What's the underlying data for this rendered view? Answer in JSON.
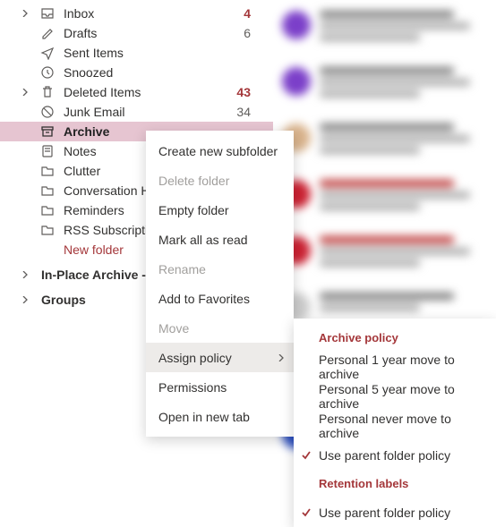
{
  "folders": {
    "inbox": {
      "label": "Inbox",
      "count": "4",
      "bold": true
    },
    "drafts": {
      "label": "Drafts",
      "count": "6"
    },
    "sent": {
      "label": "Sent Items"
    },
    "snoozed": {
      "label": "Snoozed"
    },
    "deleted": {
      "label": "Deleted Items",
      "count": "43",
      "bold": true
    },
    "junk": {
      "label": "Junk Email",
      "count": "34"
    },
    "archive": {
      "label": "Archive"
    },
    "notes": {
      "label": "Notes"
    },
    "clutter": {
      "label": "Clutter"
    },
    "conv": {
      "label": "Conversation History"
    },
    "reminders": {
      "label": "Reminders"
    },
    "rss": {
      "label": "RSS Subscriptions"
    },
    "newfolder": {
      "label": "New folder"
    }
  },
  "sections": {
    "inplace": {
      "label": "In-Place Archive -Adrian"
    },
    "groups": {
      "label": "Groups"
    }
  },
  "contextMenu": {
    "createSubfolder": "Create new subfolder",
    "deleteFolder": "Delete folder",
    "emptyFolder": "Empty folder",
    "markAllRead": "Mark all as read",
    "rename": "Rename",
    "addFavorites": "Add to Favorites",
    "move": "Move",
    "assignPolicy": "Assign policy",
    "permissions": "Permissions",
    "openNewTab": "Open in new tab"
  },
  "policyMenu": {
    "headerArchive": "Archive policy",
    "p1y": "Personal 1 year move to archive",
    "p5y": "Personal 5 year move to archive",
    "pnever": "Personal never move to archive",
    "useParent": "Use parent folder policy",
    "headerRetention": "Retention labels",
    "useParent2": "Use parent folder policy"
  }
}
